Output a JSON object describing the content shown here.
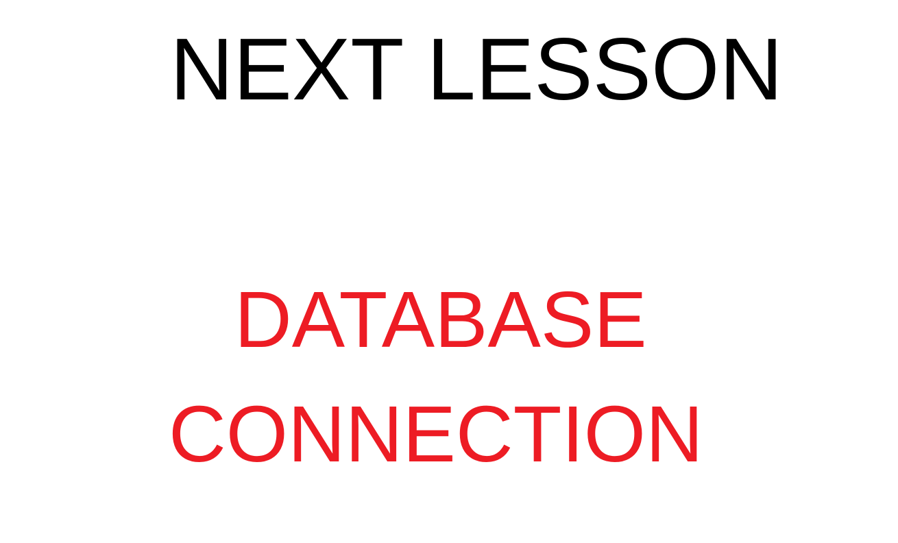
{
  "slide": {
    "heading": "NEXT LESSON",
    "topic_line_1": "DATABASE",
    "topic_line_2": "CONNECTION"
  },
  "colors": {
    "background": "#ffffff",
    "heading": "#000000",
    "topic": "#ed1c24"
  }
}
